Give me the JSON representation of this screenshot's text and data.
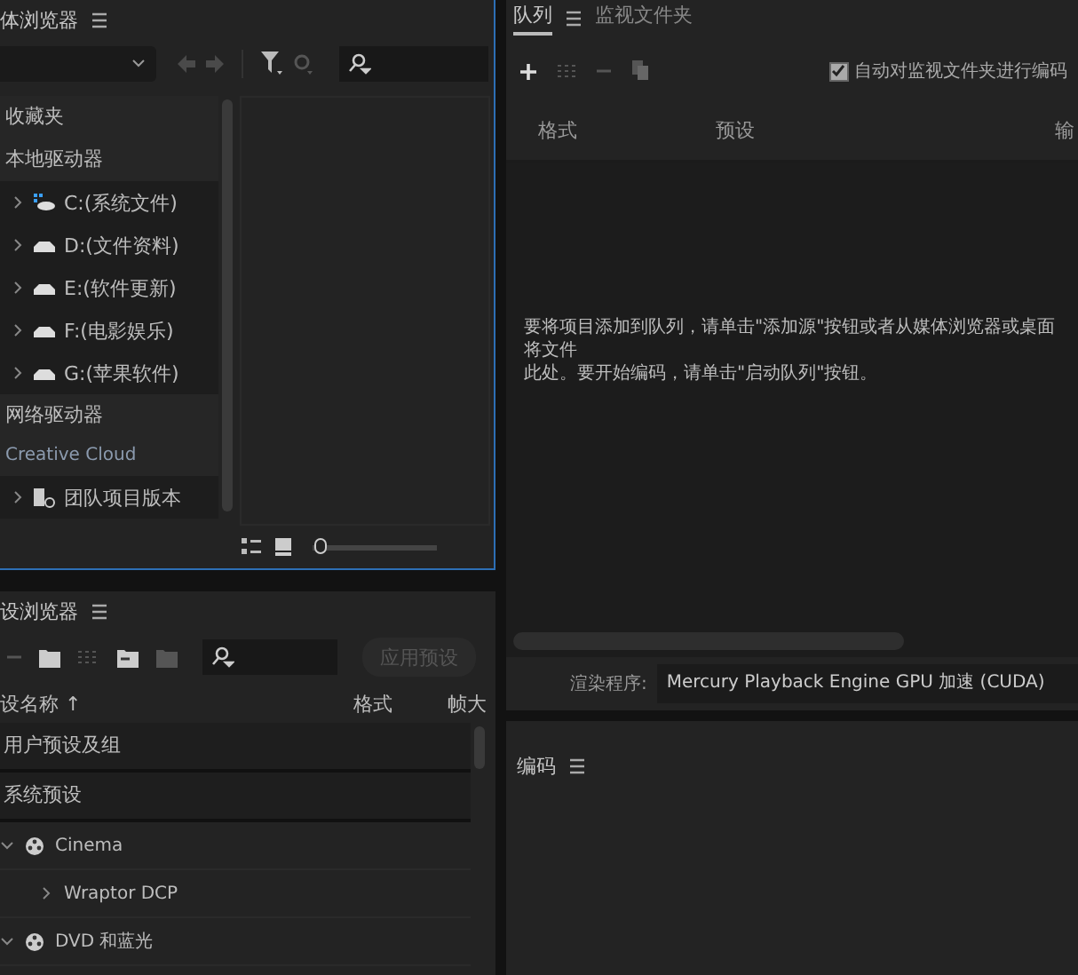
{
  "media_browser": {
    "title": "体浏览器",
    "favorites": "收藏夹",
    "local_drives": "本地驱动器",
    "drives": [
      {
        "label": "C:(系统文件)",
        "kind": "system"
      },
      {
        "label": "D:(文件资料)",
        "kind": "disk"
      },
      {
        "label": "E:(软件更新)",
        "kind": "disk"
      },
      {
        "label": "F:(电影娱乐)",
        "kind": "disk"
      },
      {
        "label": "G:(苹果软件)",
        "kind": "disk"
      }
    ],
    "network_drives": "网络驱动器",
    "creative_cloud": "Creative Cloud",
    "team_item": "团队项目版本",
    "zoom": {
      "level": 0.05
    }
  },
  "preset_browser": {
    "title": "设浏览器",
    "apply_button": {
      "label": "应用预设",
      "disabled": true
    },
    "columns": [
      "设名称 ↑",
      "格式",
      "帧大"
    ],
    "rows": [
      {
        "label": "用户预设及组",
        "kind": "group"
      },
      {
        "label": "系统预设",
        "kind": "group"
      },
      {
        "label": "Cinema",
        "kind": "category",
        "expanded": true,
        "children": [
          {
            "label": "Wraptor DCP",
            "expanded": false
          }
        ]
      },
      {
        "label": "DVD 和蓝光",
        "kind": "category",
        "expanded": true
      }
    ]
  },
  "queue": {
    "tabs": [
      {
        "label": "队列",
        "selected": true
      },
      {
        "label": "监视文件夹",
        "selected": false
      }
    ],
    "auto_encode": {
      "label": "自动对监视文件夹进行编码",
      "checked": true
    },
    "columns": [
      "格式",
      "预设",
      "输"
    ],
    "message_lines": [
      "要将项目添加到队列，请单击\"添加源\"按钮或者从媒体浏览器或桌面将文件",
      "此处。要开始编码，请单击\"启动队列\"按钮。"
    ],
    "renderer": {
      "label": "渲染程序:",
      "value": "Mercury Playback Engine GPU 加速 (CUDA)"
    }
  },
  "encoding": {
    "title": "编码"
  }
}
